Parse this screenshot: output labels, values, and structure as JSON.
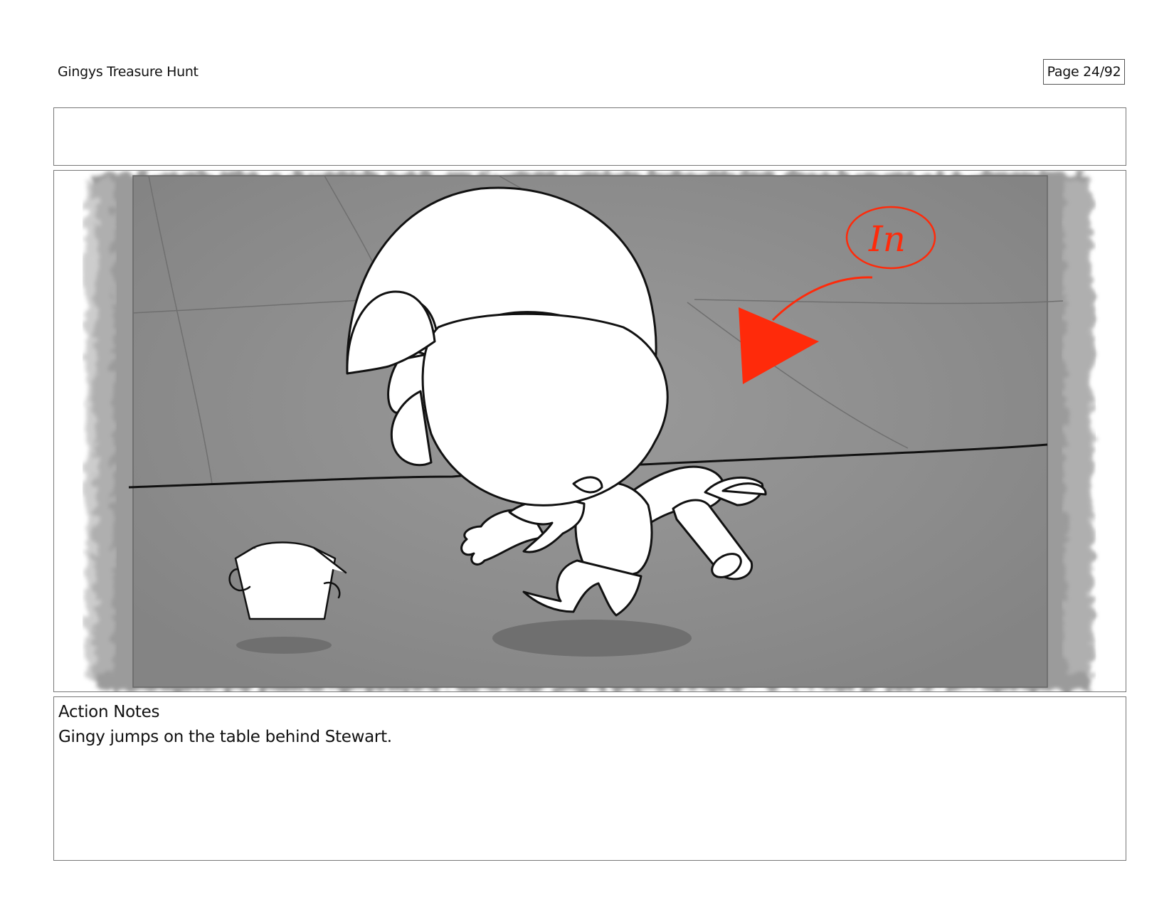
{
  "header": {
    "title": "Gingys Treasure Hunt",
    "page_label": "Page 24/92"
  },
  "frame": {
    "annotation_text": "In",
    "background_color": "#8f8f8f",
    "annotation_color": "#ff2a0a",
    "icons": [
      "storyboard-sketch-image",
      "direction-arrow-icon",
      "box-character-icon"
    ]
  },
  "notes": {
    "heading": "Action Notes",
    "text": "Gingy jumps on the table behind Stewart."
  }
}
